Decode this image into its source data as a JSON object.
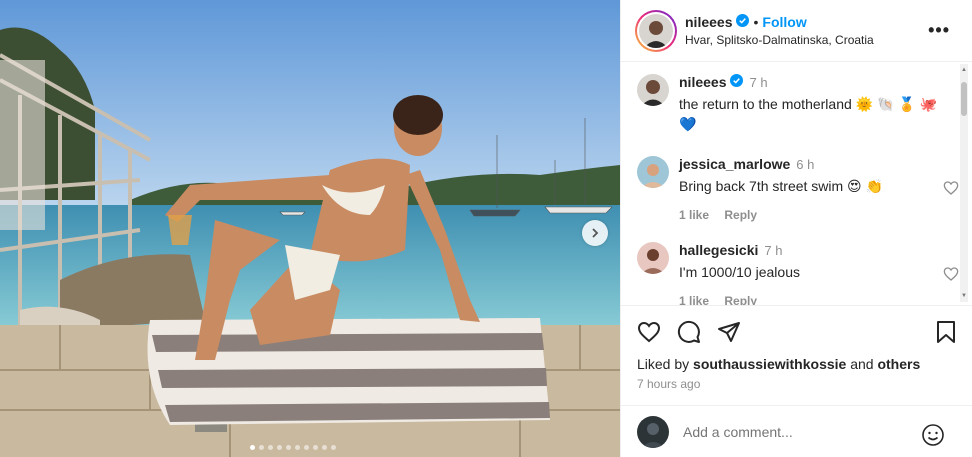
{
  "post": {
    "username": "nileees",
    "follow_label": "Follow",
    "separator": "•",
    "location": "Hvar, Splitsko-Dalmatinska, Croatia",
    "more_label": "•••",
    "carousel": {
      "dot_count": 10,
      "active_index": 0
    }
  },
  "comments": [
    {
      "user": "nileees",
      "time": "7 h",
      "text": "the return to the motherland 🌞 🐚 🏅 🐙 💙",
      "verified": true
    },
    {
      "user": "jessica_marlowe",
      "time": "6 h",
      "text": "Bring back 7th street swim 😍 👏",
      "likes": "1 like",
      "reply": "Reply"
    },
    {
      "user": "hallegesicki",
      "time": "7 h",
      "text": "I'm 1000/10 jealous",
      "likes": "1 like",
      "reply": "Reply"
    }
  ],
  "actions": {
    "liked_by_prefix": "Liked by",
    "liked_by_user": "southaussiewithkossie",
    "liked_by_and": "and",
    "liked_by_others": "others",
    "time_ago": "7 hours ago"
  },
  "add_comment": {
    "placeholder": "Add a comment..."
  },
  "colors": {
    "accent": "#0095f6",
    "muted": "#8e8e8e",
    "text": "#262626",
    "verified": "#0095f6"
  },
  "icons": [
    "verified-icon",
    "more-icon",
    "heart-icon",
    "comment-icon",
    "share-icon",
    "bookmark-icon",
    "emoji-icon",
    "chevron-right-icon"
  ]
}
